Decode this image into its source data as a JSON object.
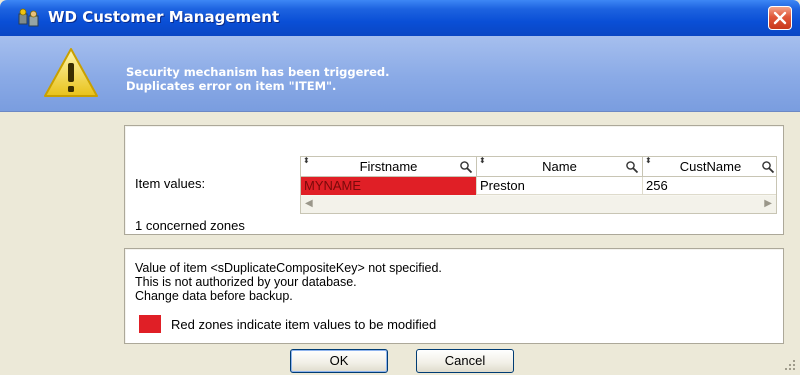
{
  "window": {
    "title": "WD Customer Management",
    "icons": {
      "app": "app-icon",
      "close": "close-icon",
      "warning": "warning-icon"
    }
  },
  "header": {
    "line1": "Security mechanism has been triggered.",
    "line2": "Duplicates error on item \"ITEM\"."
  },
  "zones": {
    "item_values_label": "Item values:",
    "concerned_zones_text": "1 concerned zones",
    "table": {
      "columns": [
        "Firstname",
        "Name",
        "CustName"
      ],
      "rows": [
        {
          "firstname": "MYNAME",
          "name": "Preston",
          "custname": "256",
          "firstname_invalid": true
        }
      ]
    }
  },
  "message": {
    "line1": "Value of item <sDuplicateCompositeKey> not specified.",
    "line2": "This is not authorized by your database.",
    "line3": "Change data before backup.",
    "legend": "Red zones indicate item values to be modified"
  },
  "colors": {
    "title_bar": "#0a4fd6",
    "header_band": "#8aaae6",
    "error_zone": "#e01f26",
    "dialog_face": "#ece9d8"
  },
  "buttons": {
    "ok": "OK",
    "cancel": "Cancel"
  }
}
